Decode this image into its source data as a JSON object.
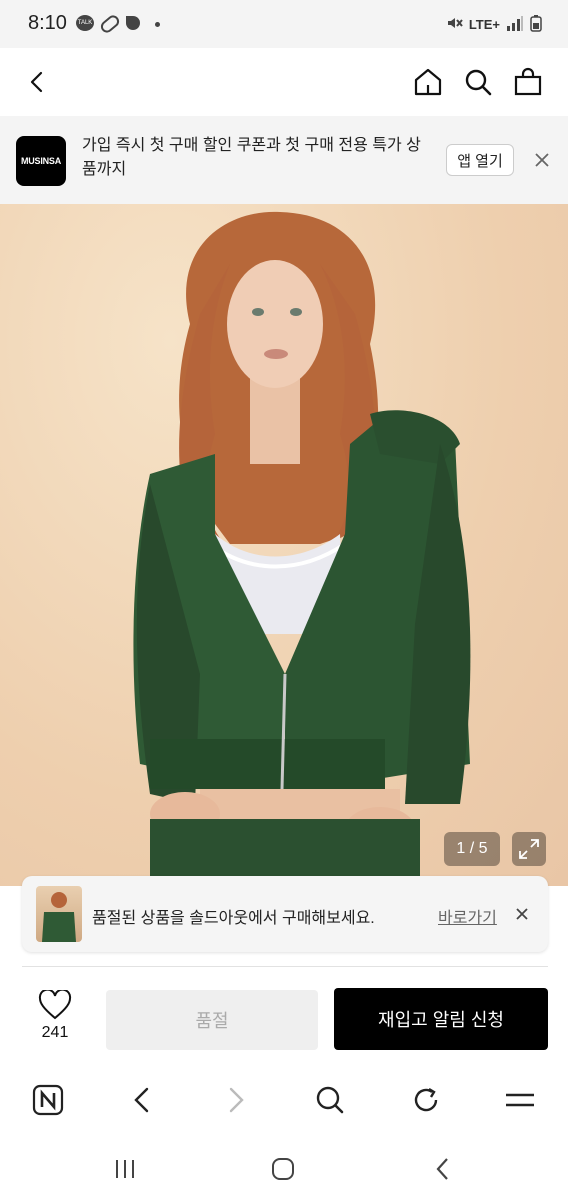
{
  "status_bar": {
    "time": "8:10",
    "talk_icon_label": "TALK",
    "network": "LTE+"
  },
  "banner": {
    "logo_text": "MUSINSA",
    "message": "가입 즉시 첫 구매 할인 쿠폰과 첫 구매 전용 특가 상품까지",
    "open_app_label": "앱 열기"
  },
  "gallery": {
    "pager": "1 / 5"
  },
  "toast": {
    "message": "품절된 상품을 솔드아웃에서 구매해보세요.",
    "link_label": "바로가기"
  },
  "purchase_bar": {
    "like_count": "241",
    "sold_out_label": "품절",
    "restock_label": "재입고 알림 신청"
  },
  "colors": {
    "accent": "#000000",
    "jacket": "#2e5533",
    "background_photo": "#efd2b3"
  }
}
